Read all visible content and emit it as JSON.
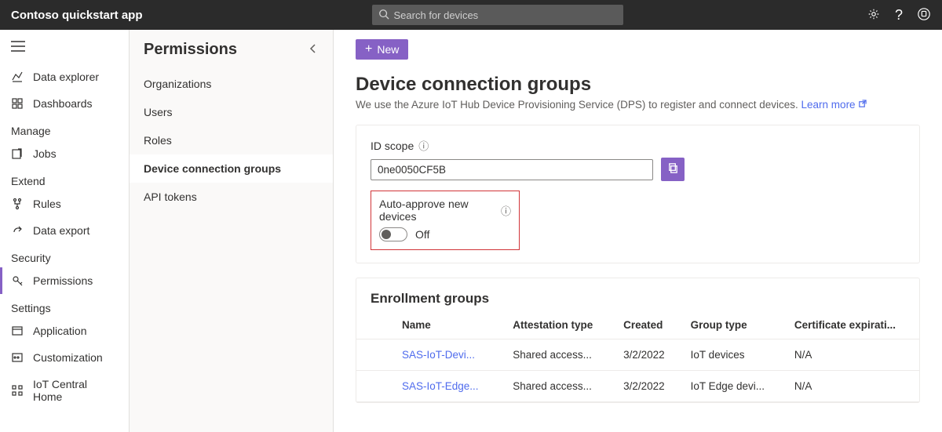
{
  "topbar": {
    "title": "Contoso quickstart app",
    "search_placeholder": "Search for devices"
  },
  "leftnav": {
    "items": [
      {
        "label": "Data explorer",
        "icon": "chart"
      },
      {
        "label": "Dashboards",
        "icon": "dash"
      }
    ],
    "manage_header": "Manage",
    "manage_items": [
      {
        "label": "Jobs",
        "icon": "jobs"
      }
    ],
    "extend_header": "Extend",
    "extend_items": [
      {
        "label": "Rules",
        "icon": "rules"
      },
      {
        "label": "Data export",
        "icon": "export"
      }
    ],
    "security_header": "Security",
    "security_items": [
      {
        "label": "Permissions",
        "icon": "perm",
        "active": true
      }
    ],
    "settings_header": "Settings",
    "settings_items": [
      {
        "label": "Application",
        "icon": "app"
      },
      {
        "label": "Customization",
        "icon": "custom"
      },
      {
        "label": "IoT Central Home",
        "icon": "home"
      }
    ]
  },
  "midnav": {
    "title": "Permissions",
    "items": [
      {
        "label": "Organizations"
      },
      {
        "label": "Users"
      },
      {
        "label": "Roles"
      },
      {
        "label": "Device connection groups",
        "active": true
      },
      {
        "label": "API tokens"
      }
    ]
  },
  "main": {
    "new_button": "New",
    "title": "Device connection groups",
    "subtitle_pre": "We use the Azure IoT Hub Device Provisioning Service (DPS) to register and connect devices. ",
    "learn_more": "Learn more",
    "id_scope_label": "ID scope",
    "id_scope_value": "0ne0050CF5B",
    "auto_approve_label": "Auto-approve new devices",
    "auto_approve_state": "Off",
    "enroll_title": "Enrollment groups",
    "table": {
      "columns": [
        "Name",
        "Attestation type",
        "Created",
        "Group type",
        "Certificate expirati..."
      ],
      "rows": [
        {
          "name": "SAS-IoT-Devi...",
          "attestation": "Shared access...",
          "created": "3/2/2022",
          "group_type": "IoT devices",
          "cert": "N/A"
        },
        {
          "name": "SAS-IoT-Edge...",
          "attestation": "Shared access...",
          "created": "3/2/2022",
          "group_type": "IoT Edge devi...",
          "cert": "N/A"
        }
      ]
    }
  }
}
